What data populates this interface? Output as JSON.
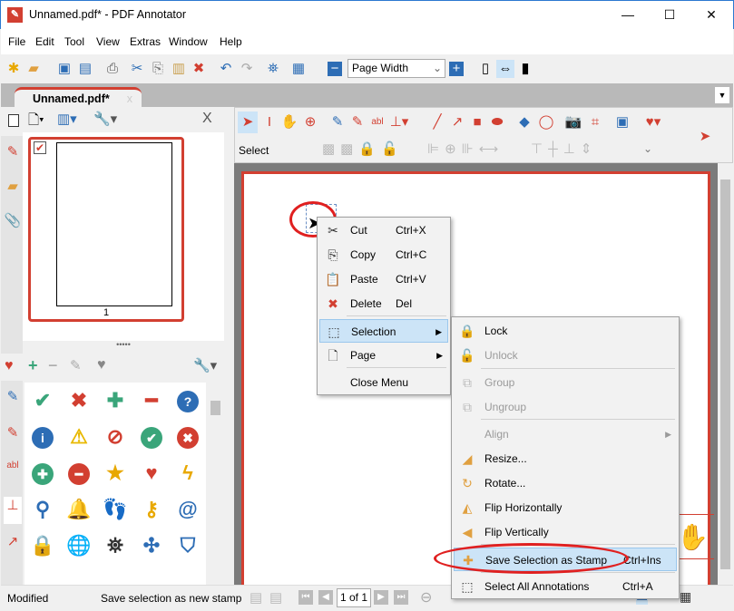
{
  "window": {
    "title": "Unnamed.pdf* - PDF Annotator",
    "minimize": "—",
    "maximize": "☐",
    "close": "✕"
  },
  "menubar": [
    "File",
    "Edit",
    "Tool",
    "View",
    "Extras",
    "Window",
    "Help"
  ],
  "toolbar": {
    "zoom_value": "Page Width"
  },
  "tabs": [
    {
      "label": "Unnamed.pdf*",
      "close": "x"
    }
  ],
  "thumbnails": {
    "page_label": "1",
    "close": "X"
  },
  "stamps": {
    "rows": [
      [
        {
          "g": "✔",
          "c": "#3aa57a"
        },
        {
          "g": "✖",
          "c": "#d23f31"
        },
        {
          "g": "✚",
          "c": "#3aa57a"
        },
        {
          "g": "━",
          "c": "#d23f31"
        },
        {
          "g": "?",
          "c": "#2d6db5",
          "circle": true
        }
      ],
      [
        {
          "g": "i",
          "c": "#2d6db5",
          "circle": true
        },
        {
          "g": "⚠",
          "c": "#e8b800"
        },
        {
          "g": "⊘",
          "c": "#d23f31"
        },
        {
          "g": "✔",
          "c": "#3aa57a",
          "circle": true
        },
        {
          "g": "✖",
          "c": "#d23f31",
          "circle": true
        }
      ],
      [
        {
          "g": "✚",
          "c": "#3aa57a",
          "circle": true
        },
        {
          "g": "━",
          "c": "#d23f31",
          "circle": true
        },
        {
          "g": "★",
          "c": "#e8a800"
        },
        {
          "g": "♥",
          "c": "#d23f31"
        },
        {
          "g": "ϟ",
          "c": "#e8a800"
        }
      ],
      [
        {
          "g": "⚲",
          "c": "#2d6db5"
        },
        {
          "g": "🔔",
          "c": "#e8a800"
        },
        {
          "g": "👣",
          "c": "#2d6db5"
        },
        {
          "g": "⚷",
          "c": "#e8a800"
        },
        {
          "g": "@",
          "c": "#2d6db5"
        }
      ],
      [
        {
          "g": "🔒",
          "c": "#e8a800"
        },
        {
          "g": "🌐",
          "c": "#2d6db5"
        },
        {
          "g": "⛯",
          "c": "#333"
        },
        {
          "g": "✣",
          "c": "#2d6db5"
        },
        {
          "g": "⛉",
          "c": "#2d6db5"
        }
      ]
    ]
  },
  "doc_toolbar": {
    "select_label": "Select"
  },
  "context_menu": {
    "items": [
      {
        "label": "Cut",
        "shortcut": "Ctrl+X",
        "icon": "cut-icon",
        "glyph": "✂"
      },
      {
        "label": "Copy",
        "shortcut": "Ctrl+C",
        "icon": "copy-icon",
        "glyph": "⎘"
      },
      {
        "label": "Paste",
        "shortcut": "Ctrl+V",
        "icon": "paste-icon",
        "glyph": "📋"
      },
      {
        "label": "Delete",
        "shortcut": "Del",
        "icon": "delete-icon",
        "glyph": "✖"
      },
      {
        "label": "Selection",
        "icon": "selection-icon",
        "glyph": "⬚",
        "submenu": true,
        "highlighted": true
      },
      {
        "label": "Page",
        "icon": "page-icon",
        "glyph": "🗋",
        "submenu": true
      },
      {
        "label": "Close Menu"
      }
    ]
  },
  "selection_submenu": {
    "items": [
      {
        "label": "Lock",
        "icon": "lock-icon",
        "glyph": "🔒"
      },
      {
        "label": "Unlock",
        "icon": "unlock-icon",
        "glyph": "🔓",
        "disabled": true
      },
      {
        "label": "Group",
        "icon": "group-icon",
        "glyph": "⧉",
        "disabled": true
      },
      {
        "label": "Ungroup",
        "icon": "ungroup-icon",
        "glyph": "⧉",
        "disabled": true
      },
      {
        "label": "Align",
        "disabled": true,
        "submenu": true
      },
      {
        "label": "Resize...",
        "icon": "resize-icon",
        "glyph": "◢"
      },
      {
        "label": "Rotate...",
        "icon": "rotate-icon",
        "glyph": "↻"
      },
      {
        "label": "Flip Horizontally",
        "icon": "flip-horizontal-icon",
        "glyph": "◭"
      },
      {
        "label": "Flip Vertically",
        "icon": "flip-vertical-icon",
        "glyph": "◀"
      },
      {
        "label": "Save Selection as Stamp",
        "shortcut": "Ctrl+Ins",
        "icon": "save-stamp-icon",
        "glyph": "✚",
        "highlighted": true
      },
      {
        "label": "Select All Annotations",
        "shortcut": "Ctrl+A",
        "icon": "select-all-icon",
        "glyph": "⬚"
      }
    ]
  },
  "statusbar": {
    "state": "Modified",
    "hint": "Save selection as new stamp",
    "page": "1 of 1"
  },
  "colors": {
    "accent": "#d23f31",
    "highlight": "#cce4f7",
    "annotation_ring": "#e02020"
  }
}
